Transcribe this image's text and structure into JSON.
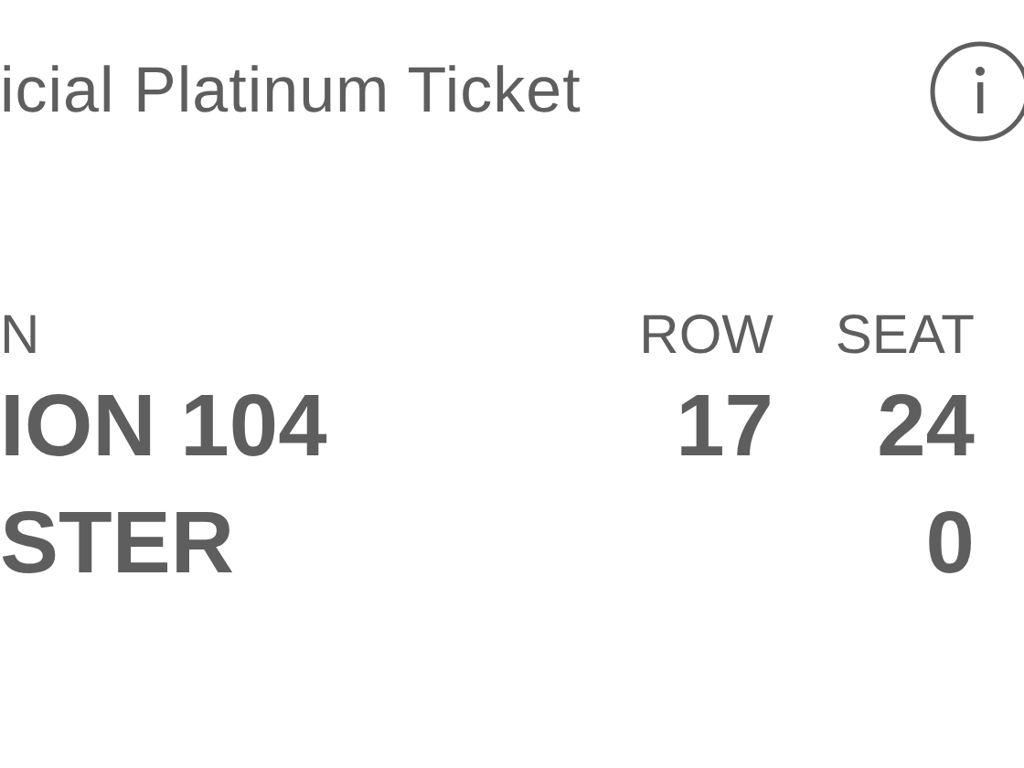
{
  "ticket": {
    "title": "icial Platinum Ticket",
    "section": {
      "label": "N",
      "values": [
        "ION 104",
        "STER"
      ]
    },
    "row": {
      "label": "ROW",
      "values": [
        "17"
      ]
    },
    "seat": {
      "label": "SEAT",
      "values": [
        "24",
        "0"
      ]
    }
  }
}
